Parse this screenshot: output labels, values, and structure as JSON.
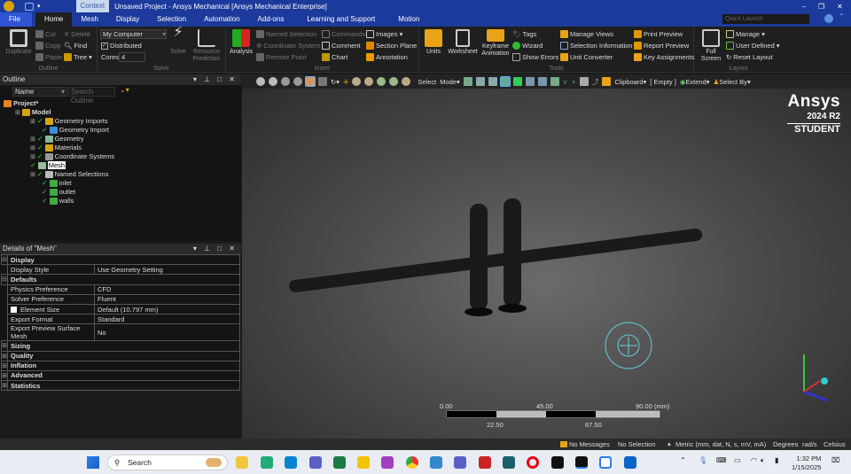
{
  "title_bar": {
    "context_tab": "Context",
    "title": "Unsaved Project - Ansys Mechanical [Ansys Mechanical Enterprise]",
    "quick_launch_placeholder": "Quick Launch",
    "min": "–",
    "restore": "❐",
    "close": "✕"
  },
  "menu_tabs": [
    "File",
    "Home",
    "Mesh",
    "Display",
    "Selection",
    "Automation",
    "Add-ons",
    "Learning and Support",
    "Motion"
  ],
  "ribbon": {
    "outline": {
      "label": "Outline",
      "duplicate": "Duplicate",
      "cut": "Cut",
      "copy": "Copy",
      "paste": "Paste",
      "delete": "Delete",
      "find": "Find",
      "tree": "Tree"
    },
    "solve": {
      "label": "Solve",
      "computer": "My Computer",
      "distributed": "Distributed",
      "cores_label": "Cores",
      "cores_value": "4",
      "solve": "Solve",
      "resource": "Resource Prediction"
    },
    "insert": {
      "label": "Insert",
      "analysis": "Analysis",
      "named_selection": "Named Selection",
      "coordinate_system": "Coordinate System",
      "remote_point": "Remote Point",
      "commands": "Commands",
      "comment": "Comment",
      "chart": "Chart",
      "images": "Images",
      "section_plane": "Section Plane",
      "annotation": "Annotation"
    },
    "tools": {
      "label": "Tools",
      "units": "Units",
      "worksheet": "Worksheet",
      "keyframe": "Keyframe Animation",
      "tags": "Tags",
      "wizard": "Wizard",
      "show_errors": "Show Errors",
      "manage_views": "Manage Views",
      "selection_information": "Selection Information",
      "unit_converter": "Unit Converter",
      "print_preview": "Print Preview",
      "report_preview": "Report Preview",
      "key_assignments": "Key Assignments"
    },
    "layout": {
      "label": "Layout",
      "full_screen": "Full Screen",
      "manage": "Manage",
      "user_defined": "User Defined",
      "reset_layout": "Reset Layout"
    }
  },
  "graphics_toolbar": {
    "select": "Select",
    "mode": "Mode",
    "clipboard": "Clipboard",
    "empty": "[ Empty ]",
    "extend": "Extend",
    "select_by": "Select By"
  },
  "outline": {
    "title": "Outline",
    "filter": "Name",
    "search_placeholder": "Search Outline",
    "tree": [
      {
        "label": "Project*",
        "level": 0
      },
      {
        "label": "Model",
        "level": 1
      },
      {
        "label": "Geometry Imports",
        "level": 2
      },
      {
        "label": "Geometry Import",
        "level": 3
      },
      {
        "label": "Geometry",
        "level": 2
      },
      {
        "label": "Materials",
        "level": 2
      },
      {
        "label": "Coordinate Systems",
        "level": 2
      },
      {
        "label": "Mesh",
        "level": 2,
        "selected": true
      },
      {
        "label": "Named Selections",
        "level": 2
      },
      {
        "label": "inlet",
        "level": 3
      },
      {
        "label": "outlet",
        "level": 3
      },
      {
        "label": "walls",
        "level": 3
      }
    ]
  },
  "details": {
    "title": "Details of \"Mesh\"",
    "rows": [
      {
        "section": "Display"
      },
      {
        "name": "Display Style",
        "value": "Use Geometry Setting"
      },
      {
        "section": "Defaults"
      },
      {
        "name": "Physics Preference",
        "value": "CFD"
      },
      {
        "name": "Solver Preference",
        "value": "Fluent"
      },
      {
        "name": "Element Size",
        "value": "Default (10.797 mm)"
      },
      {
        "name": "Export Format",
        "value": "Standard"
      },
      {
        "name": "Export Preview Surface Mesh",
        "value": "No"
      },
      {
        "section": "Sizing"
      },
      {
        "section": "Quality"
      },
      {
        "section": "Inflation"
      },
      {
        "section": "Advanced"
      },
      {
        "section": "Statistics"
      }
    ]
  },
  "viewport": {
    "brand": "Ansys",
    "version": "2024 R2",
    "edition": "STUDENT",
    "scale": {
      "t0": "0.00",
      "t1": "45.00",
      "t2": "90.00 (mm)",
      "b1": "22.50",
      "b2": "67.50"
    }
  },
  "status": {
    "messages": "No Messages",
    "selection": "No Selection",
    "units": "Metric (mm, dat, N, s, mV, mA)",
    "angle": "Degrees",
    "rot": "rad/s",
    "temp": "Celsius"
  },
  "taskbar": {
    "search": "Search",
    "time": "1:32 PM",
    "date": "1/15/2025"
  },
  "colors": {
    "title_blue": "#1c3a9c",
    "ribbon_bg": "#1f1f1f",
    "accent_orange": "#e8a317"
  }
}
